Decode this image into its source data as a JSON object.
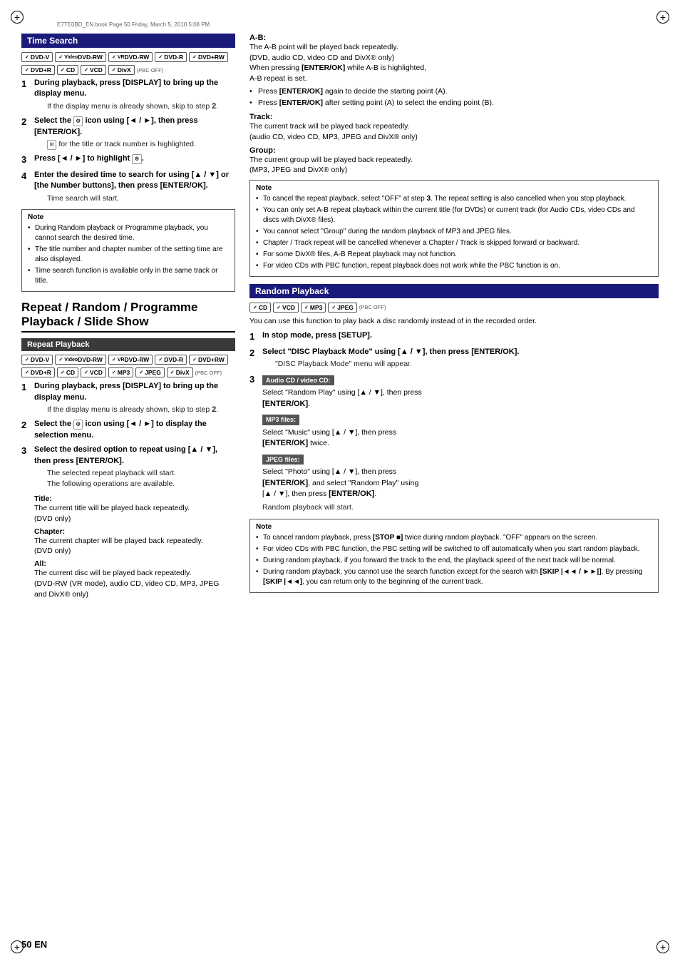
{
  "page": {
    "header": "E7TE0BD_EN.book   Page 50   Friday, March 5, 2010   5:08 PM",
    "footer": "50 EN"
  },
  "time_search": {
    "title": "Time Search",
    "formats_row1": [
      "DVD-V",
      "Video DVD-RW",
      "VR DVD-RW",
      "DVD-R",
      "DVD+RW"
    ],
    "formats_row2": [
      "DVD+R",
      "CD",
      "VCD",
      "DivX"
    ],
    "format_note": "(PBC OFF)",
    "steps": [
      {
        "num": "1",
        "bold": "During playback, press [DISPLAY] to bring up the display menu.",
        "sub": "If the display menu is already shown, skip to step 2."
      },
      {
        "num": "2",
        "bold": "Select the  icon using [◄ / ►], then press [ENTER/OK].",
        "sub": " for the title or track number is highlighted."
      },
      {
        "num": "3",
        "bold": "Press [◄ / ►] to highlight ."
      },
      {
        "num": "4",
        "bold": "Enter the desired time to search for using [▲ / ▼] or [the Number buttons], then press [ENTER/OK].",
        "sub": "Time search will start."
      }
    ],
    "note_title": "Note",
    "notes": [
      "During Random playback or Programme playback, you cannot search the desired time.",
      "The title number and chapter number of the setting time are also displayed.",
      "Time search function is available only in the same track or title."
    ]
  },
  "repeat_random_programme": {
    "title": "Repeat / Random / Programme Playback / Slide Show",
    "repeat_playback": {
      "title": "Repeat Playback",
      "formats_row1": [
        "DVD-V",
        "Video DVD-RW",
        "VR DVD-RW",
        "DVD-R",
        "DVD+RW"
      ],
      "formats_row2": [
        "DVD+R",
        "CD",
        "VCD",
        "MP3",
        "JPEG",
        "DivX"
      ],
      "format_note": "(PBC OFF)",
      "steps": [
        {
          "num": "1",
          "bold": "During playback, press [DISPLAY] to bring up the display menu.",
          "sub": "If the display menu is already shown, skip to step 2."
        },
        {
          "num": "2",
          "bold": "Select the  icon using [◄ / ►] to display the selection menu."
        },
        {
          "num": "3",
          "bold": "Select the desired option to repeat using [▲ / ▼], then press [ENTER/OK].",
          "sub": "The selected repeat playback will start.\nThe following operations are available."
        }
      ],
      "options": [
        {
          "title": "Title:",
          "body": "The current title will be played back repeatedly.\n(DVD only)"
        },
        {
          "title": "Chapter:",
          "body": "The current chapter will be played back repeatedly.\n(DVD only)"
        },
        {
          "title": "All:",
          "body": "The current disc will be played back repeatedly.\n(DVD-RW (VR mode), audio CD, video CD, MP3, JPEG\nand DivX® only)"
        }
      ]
    }
  },
  "right_column": {
    "ab_section": {
      "title": "A-B:",
      "body": "The A-B point will be played back repeatedly.\n(DVD, audio CD, video CD and DivX® only)\nWhen pressing [ENTER/OK] while A-B is highlighted,\nA-B repeat is set.",
      "bullets": [
        "Press [ENTER/OK] again to decide the starting point (A).",
        "Press [ENTER/OK] after setting point (A) to select the ending point (B)."
      ]
    },
    "track_section": {
      "title": "Track:",
      "body": "The current track will be played back repeatedly.\n(audio CD, video CD, MP3, JPEG and DivX® only)"
    },
    "group_section": {
      "title": "Group:",
      "body": "The current group will be played back repeatedly.\n(MP3, JPEG and DivX® only)"
    },
    "repeat_notes": [
      "To cancel the repeat playback, select \"OFF\" at step 3. The repeat setting is also cancelled when you stop playback.",
      "You can only set A-B repeat playback within the current title (for DVDs) or current track (for Audio CDs, video CDs and discs with DivX® files).",
      "You cannot select \"Group\" during the random playback of MP3 and JPEG files.",
      "Chapter / Track repeat will be cancelled whenever a Chapter / Track is skipped forward or backward.",
      "For some DivX® files, A-B Repeat playback may not function.",
      "For video CDs with PBC function, repeat playback does not work while the PBC function is on."
    ],
    "random_playback": {
      "title": "Random Playback",
      "formats": [
        "CD",
        "VCD",
        "MP3",
        "JPEG"
      ],
      "format_note": "(PBC OFF)",
      "intro": "You can use this function to play back a disc randomly instead of in the recorded order.",
      "steps": [
        {
          "num": "1",
          "bold": "In stop mode, press [SETUP]."
        },
        {
          "num": "2",
          "bold": "Select \"DISC Playback Mode\" using [▲ / ▼], then press [ENTER/OK].",
          "sub": "\"DISC Playback Mode\" menu will appear."
        },
        {
          "num": "3",
          "label_audio": "Audio CD / video CD:",
          "text_audio": "Select \"Random Play\" using [▲ / ▼], then press [ENTER/OK].",
          "label_mp3": "MP3 files:",
          "text_mp3": "Select \"Music\" using [▲ / ▼], then press [ENTER/OK] twice.",
          "label_jpeg": "JPEG files:",
          "text_jpeg": "Select \"Photo\" using [▲ / ▼], then press [ENTER/OK], and select \"Random Play\" using [▲ / ▼], then press [ENTER/OK].",
          "sub": "Random playback will start."
        }
      ],
      "notes": [
        "To cancel random playback, press [STOP ■] twice during random playback. \"OFF\" appears on the screen.",
        "For video CDs with PBC function, the PBC setting will be switched to off automatically when you start random playback.",
        "During random playback, if you forward the track to the end, the playback speed of the next track will be normal.",
        "During random playback, you cannot use the search function except for the search with [SKIP |◄◄ / ►►|]. By pressing [SKIP |◄◄], you can return only to the beginning of the current track."
      ]
    }
  }
}
